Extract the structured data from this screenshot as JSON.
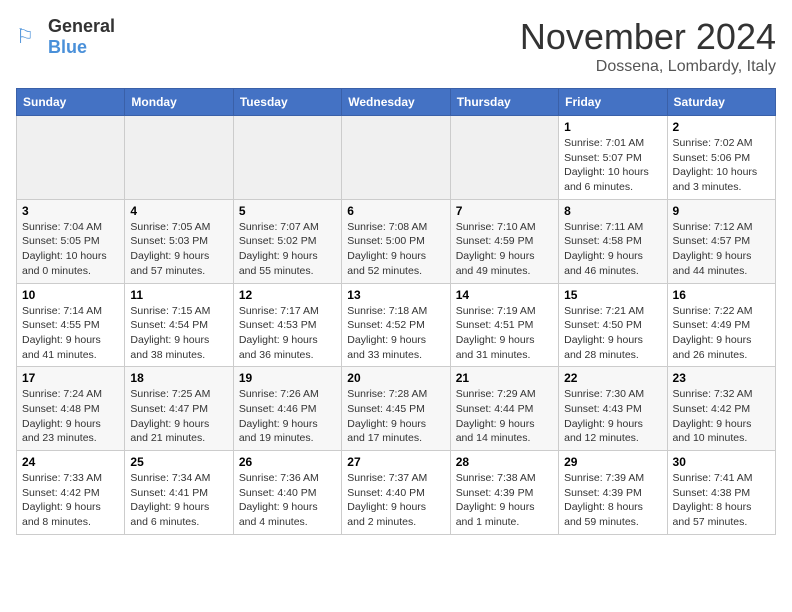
{
  "logo": {
    "text_general": "General",
    "text_blue": "Blue"
  },
  "header": {
    "month_title": "November 2024",
    "location": "Dossena, Lombardy, Italy"
  },
  "weekdays": [
    "Sunday",
    "Monday",
    "Tuesday",
    "Wednesday",
    "Thursday",
    "Friday",
    "Saturday"
  ],
  "weeks": [
    [
      {
        "day": "",
        "info": ""
      },
      {
        "day": "",
        "info": ""
      },
      {
        "day": "",
        "info": ""
      },
      {
        "day": "",
        "info": ""
      },
      {
        "day": "",
        "info": ""
      },
      {
        "day": "1",
        "info": "Sunrise: 7:01 AM\nSunset: 5:07 PM\nDaylight: 10 hours and 6 minutes."
      },
      {
        "day": "2",
        "info": "Sunrise: 7:02 AM\nSunset: 5:06 PM\nDaylight: 10 hours and 3 minutes."
      }
    ],
    [
      {
        "day": "3",
        "info": "Sunrise: 7:04 AM\nSunset: 5:05 PM\nDaylight: 10 hours and 0 minutes."
      },
      {
        "day": "4",
        "info": "Sunrise: 7:05 AM\nSunset: 5:03 PM\nDaylight: 9 hours and 57 minutes."
      },
      {
        "day": "5",
        "info": "Sunrise: 7:07 AM\nSunset: 5:02 PM\nDaylight: 9 hours and 55 minutes."
      },
      {
        "day": "6",
        "info": "Sunrise: 7:08 AM\nSunset: 5:00 PM\nDaylight: 9 hours and 52 minutes."
      },
      {
        "day": "7",
        "info": "Sunrise: 7:10 AM\nSunset: 4:59 PM\nDaylight: 9 hours and 49 minutes."
      },
      {
        "day": "8",
        "info": "Sunrise: 7:11 AM\nSunset: 4:58 PM\nDaylight: 9 hours and 46 minutes."
      },
      {
        "day": "9",
        "info": "Sunrise: 7:12 AM\nSunset: 4:57 PM\nDaylight: 9 hours and 44 minutes."
      }
    ],
    [
      {
        "day": "10",
        "info": "Sunrise: 7:14 AM\nSunset: 4:55 PM\nDaylight: 9 hours and 41 minutes."
      },
      {
        "day": "11",
        "info": "Sunrise: 7:15 AM\nSunset: 4:54 PM\nDaylight: 9 hours and 38 minutes."
      },
      {
        "day": "12",
        "info": "Sunrise: 7:17 AM\nSunset: 4:53 PM\nDaylight: 9 hours and 36 minutes."
      },
      {
        "day": "13",
        "info": "Sunrise: 7:18 AM\nSunset: 4:52 PM\nDaylight: 9 hours and 33 minutes."
      },
      {
        "day": "14",
        "info": "Sunrise: 7:19 AM\nSunset: 4:51 PM\nDaylight: 9 hours and 31 minutes."
      },
      {
        "day": "15",
        "info": "Sunrise: 7:21 AM\nSunset: 4:50 PM\nDaylight: 9 hours and 28 minutes."
      },
      {
        "day": "16",
        "info": "Sunrise: 7:22 AM\nSunset: 4:49 PM\nDaylight: 9 hours and 26 minutes."
      }
    ],
    [
      {
        "day": "17",
        "info": "Sunrise: 7:24 AM\nSunset: 4:48 PM\nDaylight: 9 hours and 23 minutes."
      },
      {
        "day": "18",
        "info": "Sunrise: 7:25 AM\nSunset: 4:47 PM\nDaylight: 9 hours and 21 minutes."
      },
      {
        "day": "19",
        "info": "Sunrise: 7:26 AM\nSunset: 4:46 PM\nDaylight: 9 hours and 19 minutes."
      },
      {
        "day": "20",
        "info": "Sunrise: 7:28 AM\nSunset: 4:45 PM\nDaylight: 9 hours and 17 minutes."
      },
      {
        "day": "21",
        "info": "Sunrise: 7:29 AM\nSunset: 4:44 PM\nDaylight: 9 hours and 14 minutes."
      },
      {
        "day": "22",
        "info": "Sunrise: 7:30 AM\nSunset: 4:43 PM\nDaylight: 9 hours and 12 minutes."
      },
      {
        "day": "23",
        "info": "Sunrise: 7:32 AM\nSunset: 4:42 PM\nDaylight: 9 hours and 10 minutes."
      }
    ],
    [
      {
        "day": "24",
        "info": "Sunrise: 7:33 AM\nSunset: 4:42 PM\nDaylight: 9 hours and 8 minutes."
      },
      {
        "day": "25",
        "info": "Sunrise: 7:34 AM\nSunset: 4:41 PM\nDaylight: 9 hours and 6 minutes."
      },
      {
        "day": "26",
        "info": "Sunrise: 7:36 AM\nSunset: 4:40 PM\nDaylight: 9 hours and 4 minutes."
      },
      {
        "day": "27",
        "info": "Sunrise: 7:37 AM\nSunset: 4:40 PM\nDaylight: 9 hours and 2 minutes."
      },
      {
        "day": "28",
        "info": "Sunrise: 7:38 AM\nSunset: 4:39 PM\nDaylight: 9 hours and 1 minute."
      },
      {
        "day": "29",
        "info": "Sunrise: 7:39 AM\nSunset: 4:39 PM\nDaylight: 8 hours and 59 minutes."
      },
      {
        "day": "30",
        "info": "Sunrise: 7:41 AM\nSunset: 4:38 PM\nDaylight: 8 hours and 57 minutes."
      }
    ]
  ]
}
